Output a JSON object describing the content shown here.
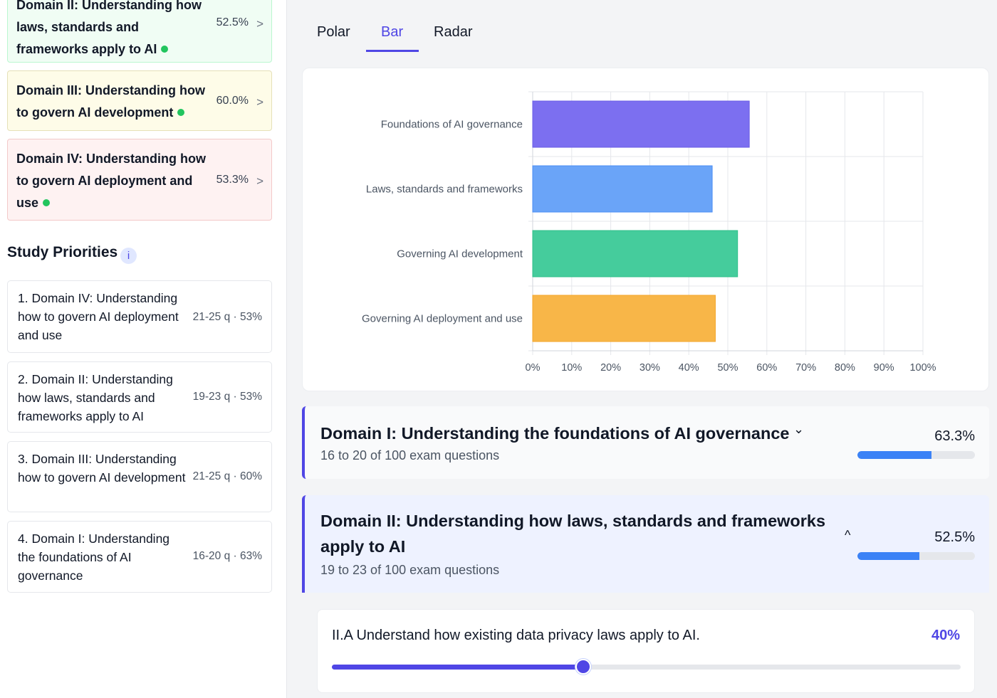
{
  "sidebar": {
    "domain_cards": [
      {
        "title": "Domain II: Understanding how laws, standards and frameworks apply to AI",
        "pct": "52.5%"
      },
      {
        "title": "Domain III: Understanding how to govern AI development",
        "pct": "60.0%"
      },
      {
        "title": "Domain IV: Understanding how to govern AI deployment and use",
        "pct": "53.3%"
      }
    ],
    "chevron": ">",
    "study_title": "Study Priorities",
    "info_glyph": "i",
    "priorities": [
      {
        "text": "1. Domain IV: Understanding how to govern AI deployment and use",
        "meta": "21-25 q · 53%"
      },
      {
        "text": "2. Domain II: Understanding how laws, standards and frameworks apply to AI",
        "meta": "19-23 q · 53%"
      },
      {
        "text": "3. Domain III: Understanding how to govern AI development",
        "meta": "21-25 q · 60%"
      },
      {
        "text": "4. Domain I: Understanding the foundations of AI governance",
        "meta": "16-20 q · 63%"
      }
    ]
  },
  "tabs": [
    {
      "label": "Polar"
    },
    {
      "label": "Bar"
    },
    {
      "label": "Radar"
    }
  ],
  "colors": {
    "accent": "#4f46e5",
    "bars": [
      "#7c6ff0",
      "#6aa4f8",
      "#45cc9c",
      "#f8b648"
    ],
    "bar_strokes": [
      "#6a5ce6",
      "#4b8ef4",
      "#2fbf8a",
      "#f3a52a"
    ]
  },
  "chart_data": {
    "type": "bar",
    "orientation": "horizontal",
    "categories": [
      "Foundations of AI governance",
      "Laws, standards and frameworks",
      "Governing AI development",
      "Governing AI deployment and use"
    ],
    "values": [
      55.5,
      46,
      52.5,
      46.8
    ],
    "xlim": [
      0,
      100
    ],
    "xticks": [
      "0%",
      "10%",
      "20%",
      "30%",
      "40%",
      "50%",
      "60%",
      "70%",
      "80%",
      "90%",
      "100%"
    ],
    "grid": true
  },
  "panels": [
    {
      "title": "Domain I: Understanding the foundations of AI governance",
      "sub": "16 to 20 of 100 exam questions",
      "pct": "63.3%",
      "progress": 63.3,
      "caret": "⌄"
    },
    {
      "title": "Domain II: Understanding how laws, standards and frameworks apply to AI",
      "sub": "19 to 23 of 100 exam questions",
      "pct": "52.5%",
      "progress": 52.5,
      "caret": "^"
    }
  ],
  "subdomain": {
    "title": "II.A Understand how existing data privacy laws apply to AI.",
    "pct": "40%",
    "value": 40
  }
}
